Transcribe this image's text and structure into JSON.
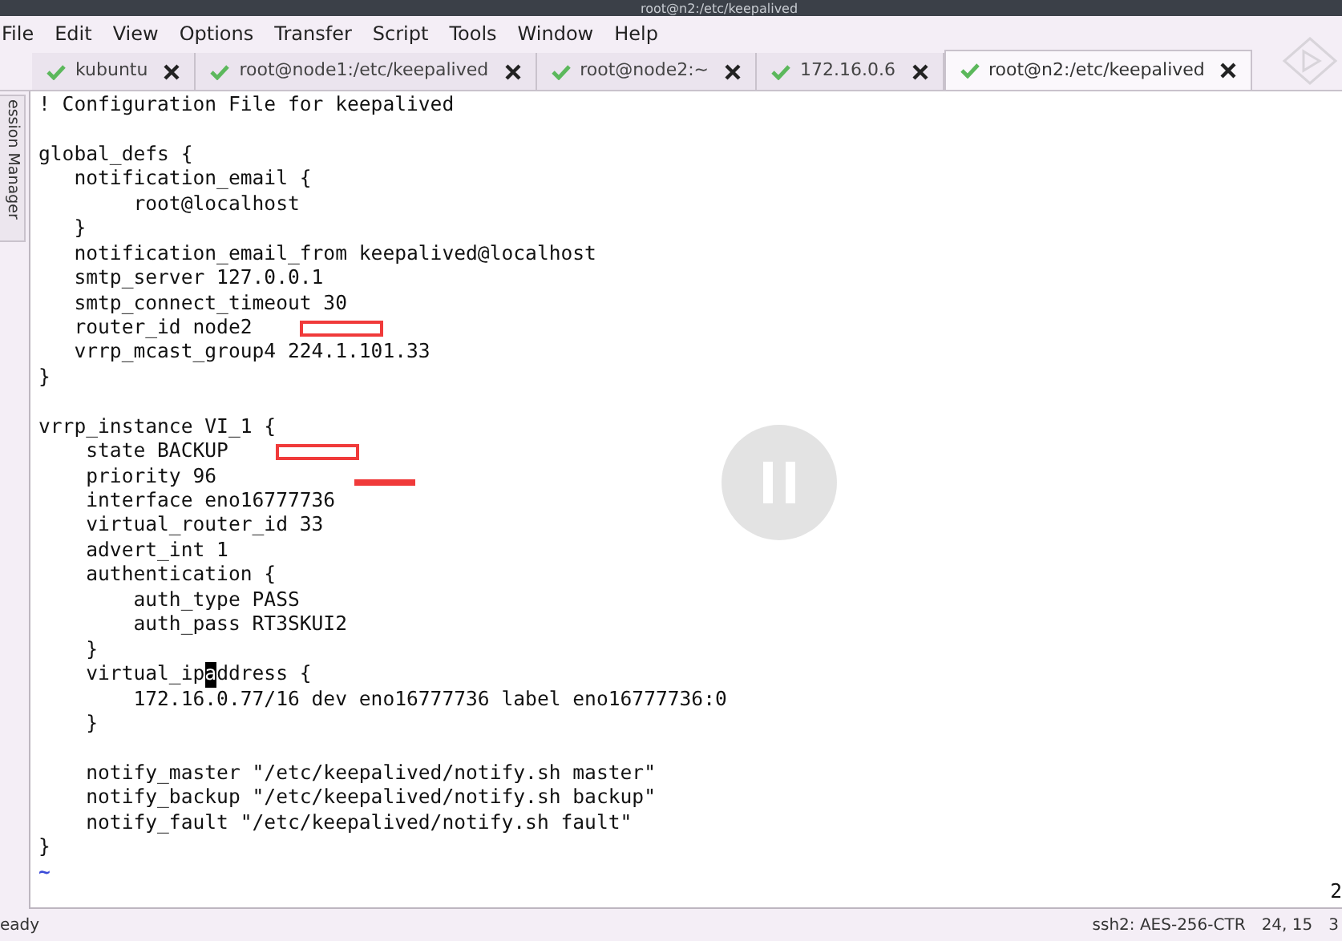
{
  "window": {
    "title": "root@n2:/etc/keepalived"
  },
  "menu": [
    "File",
    "Edit",
    "View",
    "Options",
    "Transfer",
    "Script",
    "Tools",
    "Window",
    "Help"
  ],
  "tabs": [
    {
      "label": "kubuntu",
      "selected": false
    },
    {
      "label": "root@node1:/etc/keepalived",
      "selected": false
    },
    {
      "label": "root@node2:~",
      "selected": false
    },
    {
      "label": "172.16.0.6",
      "selected": false
    },
    {
      "label": "root@n2:/etc/keepalived",
      "selected": true
    }
  ],
  "side_tab": "ession Manager",
  "terminal": {
    "lines": [
      {
        "kind": "text",
        "text": "! Configuration File for keepalived"
      },
      {
        "kind": "blank"
      },
      {
        "kind": "text",
        "text": "global_defs {"
      },
      {
        "kind": "text",
        "text": "   notification_email {"
      },
      {
        "kind": "text",
        "text": "        root@localhost"
      },
      {
        "kind": "text",
        "text": "   }"
      },
      {
        "kind": "text",
        "text": "   notification_email_from keepalived@localhost"
      },
      {
        "kind": "text",
        "text": "   smtp_server 127.0.0.1"
      },
      {
        "kind": "text",
        "text": "   smtp_connect_timeout 30"
      },
      {
        "kind": "text",
        "text": "   router_id node2",
        "boxed": true
      },
      {
        "kind": "text",
        "text": "   vrrp_mcast_group4 224.1.101.33"
      },
      {
        "kind": "text",
        "text": "}"
      },
      {
        "kind": "blank"
      },
      {
        "kind": "text",
        "text": "vrrp_instance VI_1 {"
      },
      {
        "kind": "text",
        "text": "    state BACKUP",
        "boxed": true
      },
      {
        "kind": "text",
        "text": "    priority 96",
        "underlined": true
      },
      {
        "kind": "text",
        "text": "    interface eno16777736"
      },
      {
        "kind": "text",
        "text": "    virtual_router_id 33"
      },
      {
        "kind": "text",
        "text": "    advert_int 1"
      },
      {
        "kind": "text",
        "text": "    authentication {"
      },
      {
        "kind": "text",
        "text": "        auth_type PASS"
      },
      {
        "kind": "text",
        "text": "        auth_pass RT3SKUI2"
      },
      {
        "kind": "text",
        "text": "    }"
      },
      {
        "kind": "cursor",
        "before": "    virtual_ip",
        "cursor": "a",
        "after": "ddress {"
      },
      {
        "kind": "text",
        "text": "        172.16.0.77/16 dev eno16777736 label eno16777736:0"
      },
      {
        "kind": "text",
        "text": "    }"
      },
      {
        "kind": "blank"
      },
      {
        "kind": "text",
        "text": "    notify_master \"/etc/keepalived/notify.sh master\""
      },
      {
        "kind": "text",
        "text": "    notify_backup \"/etc/keepalived/notify.sh backup\""
      },
      {
        "kind": "text",
        "text": "    notify_fault \"/etc/keepalived/notify.sh fault\""
      },
      {
        "kind": "text",
        "text": "}"
      },
      {
        "kind": "tilde",
        "text": "~"
      }
    ],
    "position_fragment": "2"
  },
  "status_bar": {
    "message": "eady",
    "cipher": "ssh2: AES-256-CTR",
    "position": "24, 15",
    "extra": "3"
  }
}
